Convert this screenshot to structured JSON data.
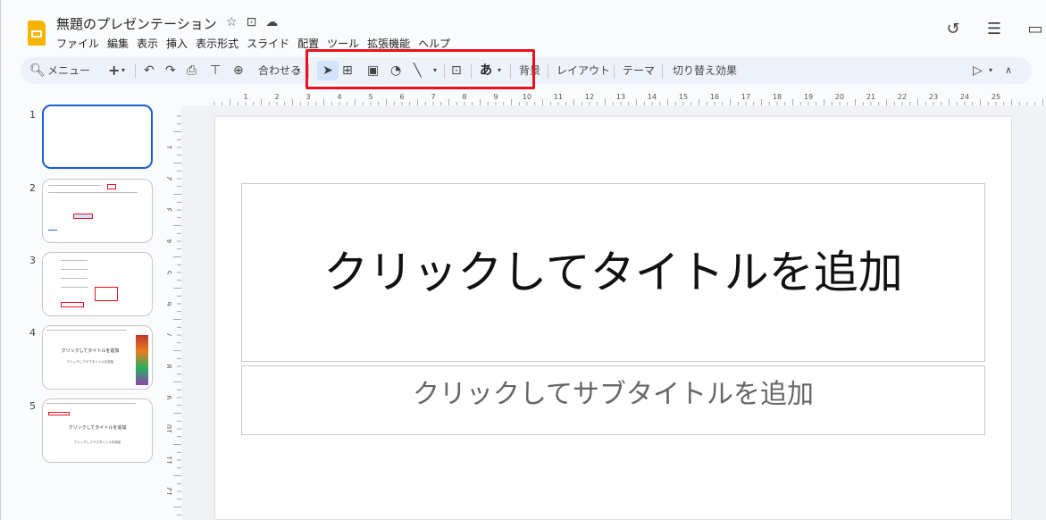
{
  "document": {
    "title": "無題のプレゼンテーション"
  },
  "title_icons": [
    "☆",
    "⊡",
    "☁"
  ],
  "menubar": [
    "ファイル",
    "編集",
    "表示",
    "挿入",
    "表示形式",
    "スライド",
    "配置",
    "ツール",
    "拡張機能",
    "ヘルプ"
  ],
  "header_right": [
    "↺",
    "☰",
    "▭"
  ],
  "toolbar": {
    "search_label": "メニュー",
    "zoom_label": "合わせる",
    "background_label": "背景",
    "layout_label": "レイアウト",
    "theme_label": "テーマ",
    "transition_label": "切り替え効果",
    "text_style_label": "あ"
  },
  "slides": [
    {
      "number": "1"
    },
    {
      "number": "2"
    },
    {
      "number": "3"
    },
    {
      "number": "4",
      "title": "クリックしてタイトルを追加",
      "subtitle": "クリックしてサブタイトルを追加"
    },
    {
      "number": "5",
      "title": "クリックしてタイトルを追加",
      "subtitle": "クリックしてサブタイトルを追加"
    }
  ],
  "ruler": {
    "top": [
      "1",
      "2",
      "3",
      "4",
      "5",
      "6",
      "7",
      "8",
      "9",
      "10",
      "11",
      "12",
      "13",
      "14",
      "15",
      "16",
      "17",
      "18",
      "19",
      "20",
      "21",
      "22",
      "23",
      "24",
      "25"
    ],
    "left": [
      "1",
      "2",
      "3",
      "4",
      "5",
      "6",
      "7",
      "8",
      "9",
      "10",
      "11",
      "12"
    ]
  },
  "slide": {
    "title_placeholder": "クリックしてタイトルを追加",
    "subtitle_placeholder": "クリックしてサブタイトルを追加"
  },
  "colors": {
    "accent": "#1a5fd0",
    "highlight": "#e8131e",
    "toolbar_bg": "#edf2fa",
    "logo": "#f4b400"
  }
}
